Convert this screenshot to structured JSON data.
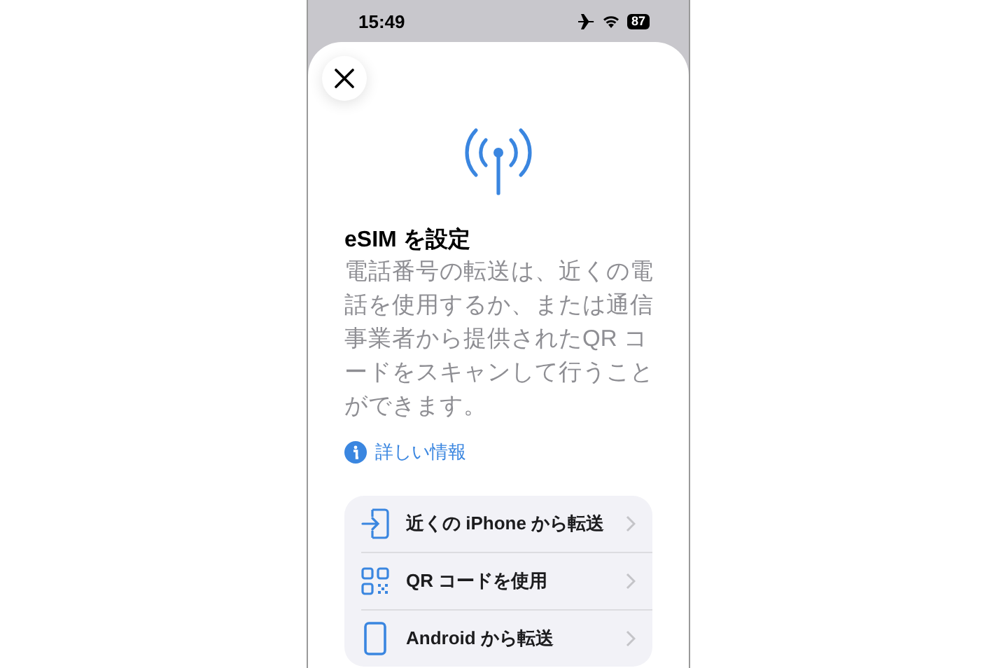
{
  "status_bar": {
    "time": "15:49",
    "battery": "87"
  },
  "sheet": {
    "title": "eSIM を設定",
    "description": "電話番号の転送は、近くの電話を使用するか、または通信事業者から提供されたQR コードをスキャンして行うことができます。",
    "info_link": "詳しい情報"
  },
  "options": [
    {
      "kind": "transfer",
      "label": "近くの iPhone から転送"
    },
    {
      "kind": "qr",
      "label": "QR コードを使用"
    },
    {
      "kind": "phone",
      "label": "Android から転送"
    }
  ]
}
